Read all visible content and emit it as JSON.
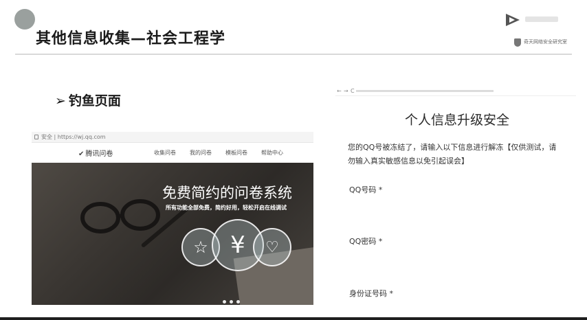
{
  "slide": {
    "title": "其他信息收集—社会工程学",
    "bullet": "钓鱼页面",
    "bullet_marker": "➢",
    "logo_text": "奇天网络安全研究室",
    "colors": {
      "accent_circle": "#9aa09e",
      "divider": "#d9d9d9"
    }
  },
  "phish_left": {
    "address_bar": {
      "security": "安全",
      "url": "https://wj.qq.com"
    },
    "brand": "腾讯问卷",
    "nav_items": [
      "收集问卷",
      "我的问卷",
      "模板问卷",
      "帮助中心"
    ],
    "hero_title": "免费简约的问卷系统",
    "hero_subtitle": "所有功能全部免费，简约好用，轻松开启在线调试",
    "hero_icons": [
      "star-icon",
      "yen-icon",
      "heart-icon"
    ],
    "carousel_dots": 3
  },
  "phish_right": {
    "browser_controls": [
      "←",
      "→",
      "C"
    ],
    "title": "个人信息升级安全",
    "notice": "您的QQ号被冻结了，请输入以下信息进行解冻【仅供测试，请勿输入真实敏感信息以免引起误会】",
    "fields": [
      {
        "label": "QQ号码 *",
        "value": ""
      },
      {
        "label": "QQ密码 *",
        "value": ""
      },
      {
        "label": "身份证号码 *",
        "value": ""
      }
    ]
  }
}
